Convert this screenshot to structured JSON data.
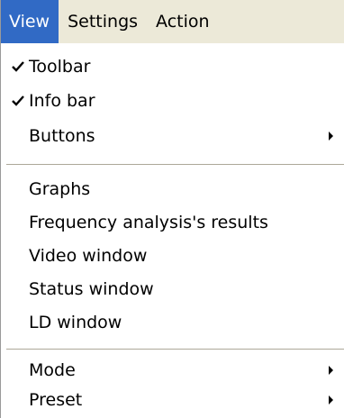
{
  "menubar": {
    "items": [
      {
        "label": "View"
      },
      {
        "label": "Settings"
      },
      {
        "label": "Action"
      }
    ]
  },
  "dropdown": {
    "items": [
      {
        "label": "Toolbar",
        "checked": true
      },
      {
        "label": "Info bar",
        "checked": true
      },
      {
        "label": "Buttons",
        "submenu": true
      },
      {
        "label": "Graphs"
      },
      {
        "label": "Frequency analysis's results"
      },
      {
        "label": "Video window"
      },
      {
        "label": "Status window"
      },
      {
        "label": "LD window"
      },
      {
        "label": "Mode",
        "submenu": true
      },
      {
        "label": "Preset",
        "submenu": true
      }
    ]
  },
  "colors": {
    "highlight": "#316ac5",
    "menubar_bg": "#ece9d8",
    "separator": "#aca899"
  }
}
